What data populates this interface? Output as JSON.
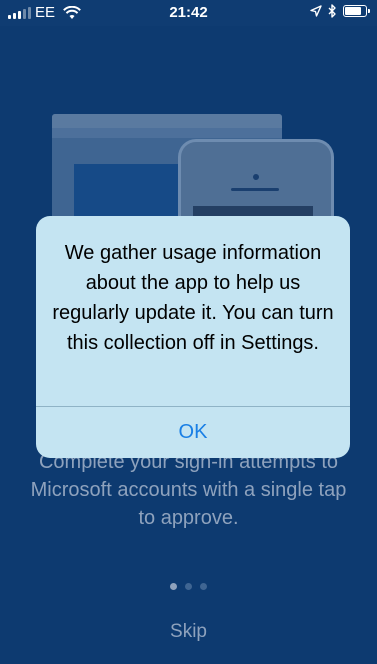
{
  "status_bar": {
    "carrier": "EE",
    "time": "21:42",
    "signal_bars_filled": 3
  },
  "icons": {
    "wifi": "wifi-icon",
    "location": "location-arrow-icon",
    "bluetooth": "bluetooth-icon",
    "battery": "battery-icon"
  },
  "onboarding": {
    "description": "Complete your sign-in attempts to Microsoft accounts with a single tap to approve.",
    "pager_total": 3,
    "pager_active": 1,
    "skip_label": "Skip"
  },
  "alert": {
    "message": "We gather usage information about the app to help us regularly update it. You can turn this collection off in Settings.",
    "ok_label": "OK"
  },
  "colors": {
    "background": "#0d3a70",
    "alert_background": "#c4e4f2",
    "alert_button": "#1a7fe5",
    "dimmed_text": "#8ea2bd"
  }
}
